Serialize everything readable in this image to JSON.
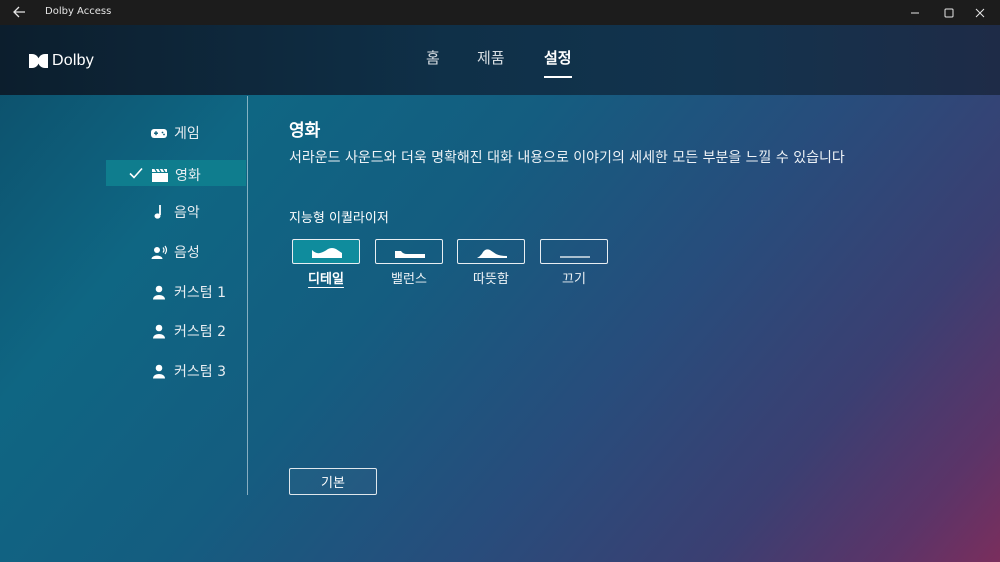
{
  "window": {
    "title": "Dolby Access"
  },
  "header": {
    "logo_text": "Dolby",
    "nav": [
      {
        "label": "홈",
        "active": false
      },
      {
        "label": "제품",
        "active": false
      },
      {
        "label": "설정",
        "active": true
      }
    ]
  },
  "sidebar": {
    "items": [
      {
        "label": "게임",
        "icon": "gamepad-icon",
        "selected": false
      },
      {
        "label": "영화",
        "icon": "clapperboard-icon",
        "selected": true
      },
      {
        "label": "음악",
        "icon": "music-note-icon",
        "selected": false
      },
      {
        "label": "음성",
        "icon": "voice-icon",
        "selected": false
      },
      {
        "label": "커스텀 1",
        "icon": "person-icon",
        "selected": false
      },
      {
        "label": "커스텀 2",
        "icon": "person-icon",
        "selected": false
      },
      {
        "label": "커스텀 3",
        "icon": "person-icon",
        "selected": false
      }
    ]
  },
  "main": {
    "title": "영화",
    "description": "서라운드 사운드와 더욱 명확해진 대화 내용으로 이야기의 세세한 모든 부분을 느낄 수 있습니다",
    "equalizer_label": "지능형 이퀄라이저",
    "presets": [
      {
        "label": "디테일",
        "icon": "eq-detail-icon",
        "active": true
      },
      {
        "label": "밸런스",
        "icon": "eq-balanced-icon",
        "active": false
      },
      {
        "label": "따뜻함",
        "icon": "eq-warm-icon",
        "active": false
      },
      {
        "label": "끄기",
        "icon": "eq-off-icon",
        "active": false
      }
    ],
    "default_button": "기본"
  },
  "colors": {
    "titlebar": "#1c1c1c",
    "header": "#0f3048",
    "selected_item": "#0f7d8e",
    "active_preset": "#0f8c9d"
  }
}
